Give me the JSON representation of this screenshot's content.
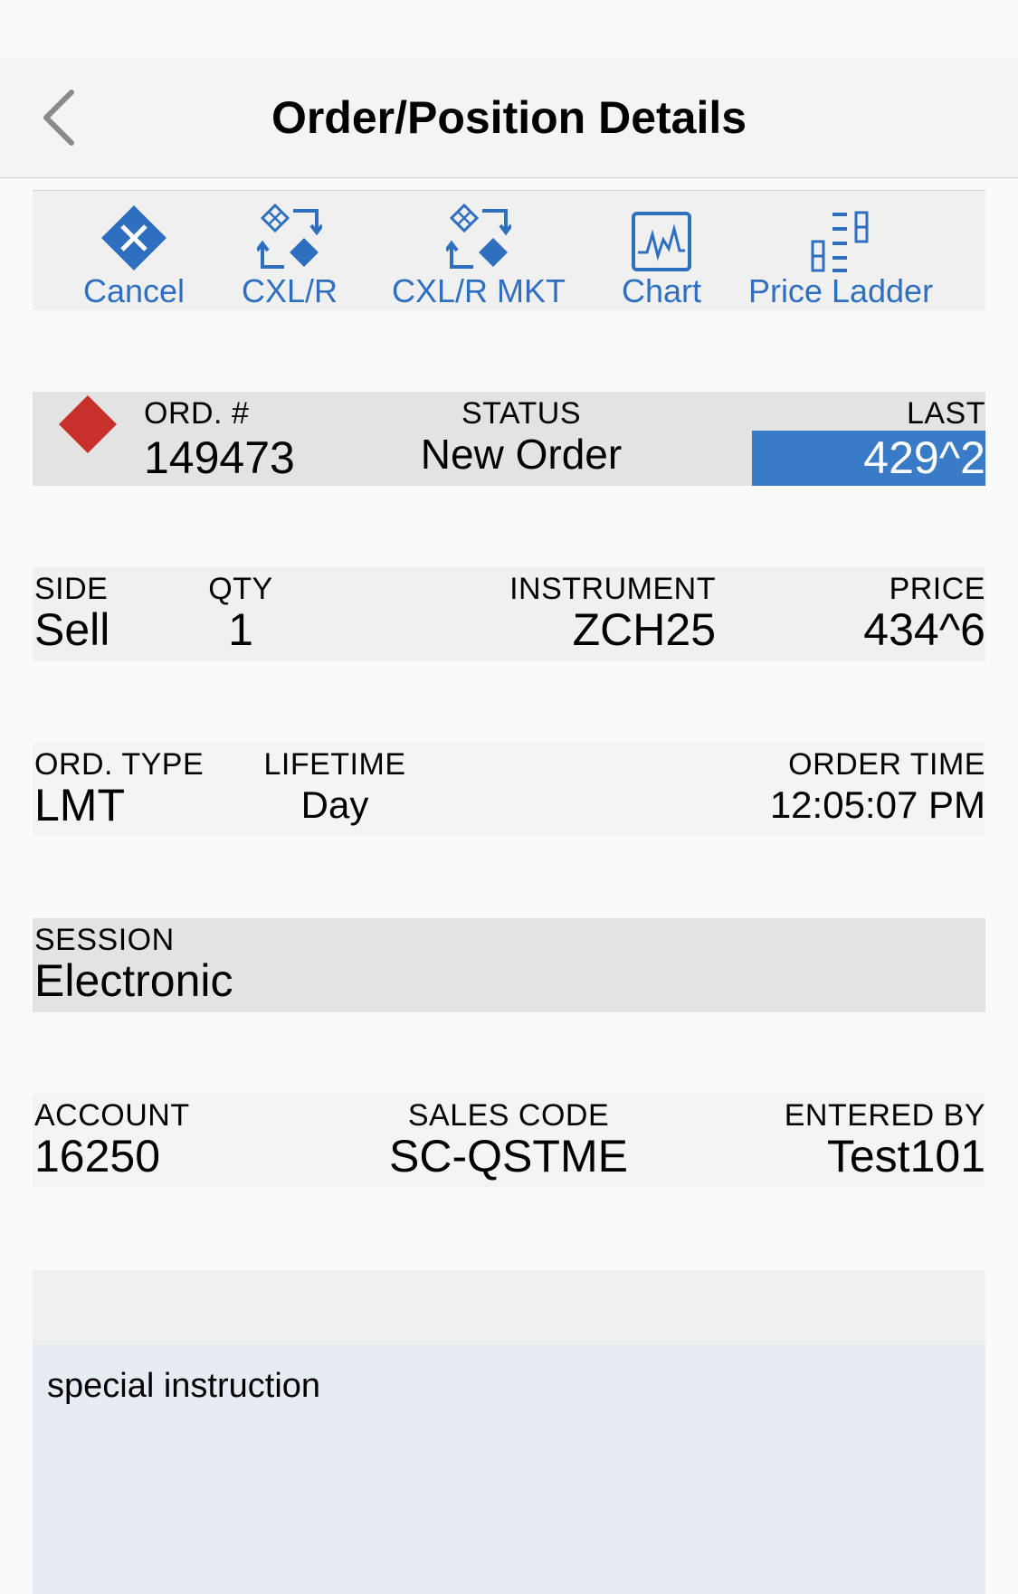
{
  "header": {
    "title": "Order/Position Details",
    "back_icon": "chevron-left-icon"
  },
  "toolbar": {
    "items": [
      {
        "label": "Cancel",
        "icon": "cancel-x-diamond-icon"
      },
      {
        "label": "CXL/R",
        "icon": "cancel-replace-icon"
      },
      {
        "label": "CXL/R MKT",
        "icon": "cancel-replace-market-icon"
      },
      {
        "label": "Chart",
        "icon": "chart-icon"
      },
      {
        "label": "Price Ladder",
        "icon": "price-ladder-icon"
      }
    ],
    "accent": "#2f6fc0"
  },
  "order": {
    "order_number_label": "ORD. #",
    "order_number": "149473",
    "status_label": "STATUS",
    "status": "New Order",
    "last_label": "LAST",
    "last": "429^2",
    "side_indicator_color": "#c8312b",
    "last_highlight_color": "#3a7bc8"
  },
  "details": {
    "side_label": "SIDE",
    "side": "Sell",
    "qty_label": "QTY",
    "qty": "1",
    "instrument_label": "INSTRUMENT",
    "instrument": "ZCH25",
    "price_label": "PRICE",
    "price": "434^6",
    "ord_type_label": "ORD. TYPE",
    "ord_type": "LMT",
    "lifetime_label": "LIFETIME",
    "lifetime": "Day",
    "order_time_label": "ORDER TIME",
    "order_time": "12:05:07 PM",
    "session_label": "SESSION",
    "session": "Electronic",
    "account_label": "ACCOUNT",
    "account": "16250",
    "sales_code_label": "SALES CODE",
    "sales_code": "SC-QSTME",
    "entered_by_label": "ENTERED BY",
    "entered_by": "Test101"
  },
  "notes": {
    "text": "special instruction"
  }
}
